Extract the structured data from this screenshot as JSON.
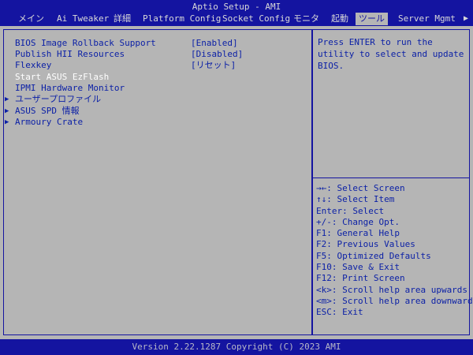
{
  "header": {
    "title": "Aptio Setup - AMI",
    "tabs": [
      {
        "label": "メイン"
      },
      {
        "label": "Ai Tweaker"
      },
      {
        "label": "詳細"
      },
      {
        "label": "Platform Config"
      },
      {
        "label": "Socket Config"
      },
      {
        "label": "モニタ"
      },
      {
        "label": "起動"
      },
      {
        "label": "ツール"
      },
      {
        "label": "Server Mgmt"
      }
    ],
    "more_arrow": "▶"
  },
  "menu": {
    "items": [
      {
        "label": "BIOS Image Rollback Support",
        "value": "[Enabled]"
      },
      {
        "label": "Publish HII Resources",
        "value": "[Disabled]"
      },
      {
        "label": "Flexkey",
        "value": "[リセット]"
      },
      {
        "label": "Start ASUS EzFlash",
        "value": ""
      },
      {
        "label": "IPMI Hardware Monitor",
        "value": ""
      },
      {
        "label": "ユーザープロファイル",
        "arrow": "▶"
      },
      {
        "label": "ASUS SPD 情報",
        "arrow": "▶"
      },
      {
        "label": "Armoury Crate",
        "arrow": "▶"
      }
    ]
  },
  "help": {
    "text": "Press ENTER to run the utility to select and update BIOS."
  },
  "keys": [
    "→←: Select Screen",
    "↑↓: Select Item",
    "Enter: Select",
    "+/-: Change Opt.",
    "F1: General Help",
    "F2: Previous Values",
    "F5: Optimized Defaults",
    "F10: Save & Exit",
    "F12: Print Screen",
    "<k>: Scroll help area upwards",
    "<m>: Scroll help area downwards",
    "ESC: Exit"
  ],
  "footer": {
    "version": "Version 2.22.1287 Copyright (C) 2023 AMI"
  },
  "colors": {
    "bar_blue": "#1414a0",
    "panel_gray": "#b5b5b5",
    "text_blue": "#0a1fa6",
    "highlight_white": "#ffffff"
  }
}
